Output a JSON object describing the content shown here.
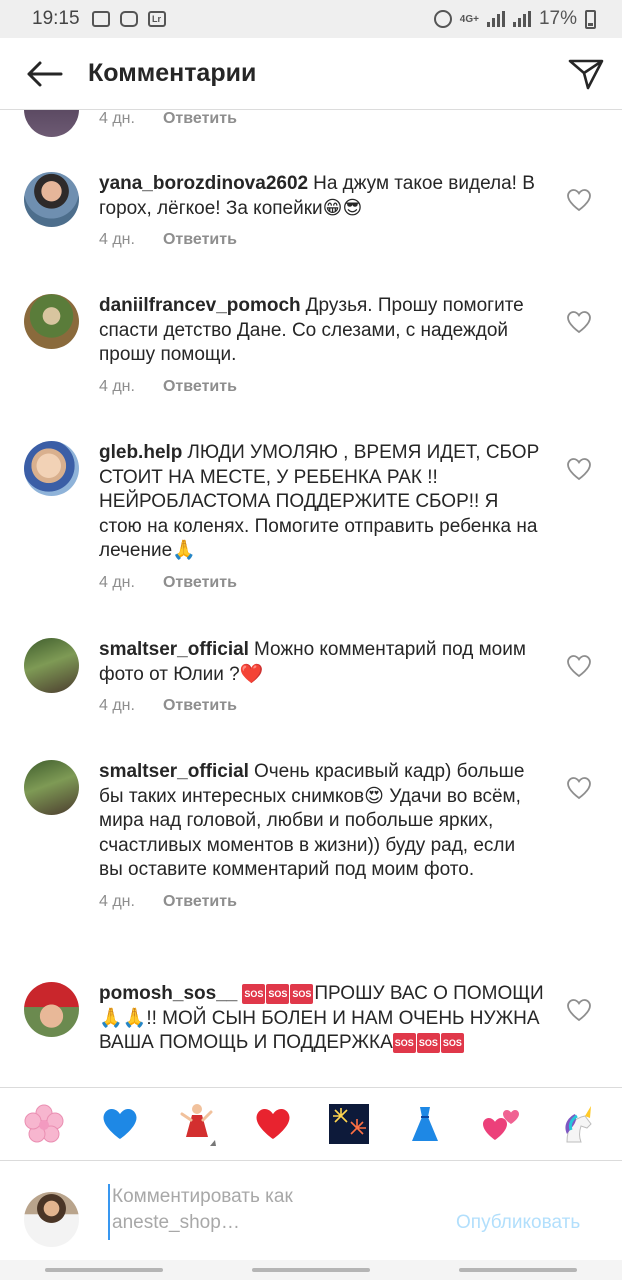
{
  "status_bar": {
    "time": "19:15",
    "network": "4G+",
    "battery": "17%",
    "lr_label": "Lr"
  },
  "header": {
    "title": "Комментарии"
  },
  "labels": {
    "reply": "Ответить"
  },
  "partial_comment": {
    "time": "4 дн."
  },
  "comments": [
    {
      "username": "yana_borozdinova2602",
      "text": "На джум такое видела! В горох, лёгкое! За копейки😁😎",
      "time": "4 дн."
    },
    {
      "username": "daniilfrancev_pomoch",
      "text": "Друзья. Прошу помогите спасти детство Дане. Со слезами, с надеждой прошу помощи.",
      "time": "4 дн."
    },
    {
      "username": "gleb.help",
      "text": "ЛЮДИ УМОЛЯЮ , ВРЕМЯ ИДЕТ, СБОР СТОИТ НА МЕСТЕ, У РЕБЕНКА РАК !! НЕЙРОБЛАСТОМА ПОДДЕРЖИТЕ СБОР!! Я стою на коленях. Помогите отправить ребенка на лечение🙏",
      "time": "4 дн."
    },
    {
      "username": "smaltser_official",
      "text": "Можно комментарий под моим фото от Юлии ?❤️",
      "time": "4 дн."
    },
    {
      "username": "smaltser_official",
      "text": "Очень красивый кадр) больше бы таких интересных снимков😍 Удачи во всём, мира над головой, любви и побольше ярких, счастливых моментов в жизни)) буду рад, если вы оставите комментарий под моим фото.",
      "time": "4 дн."
    },
    {
      "username": "pomosh_sos__",
      "text_a": "ПРОШУ ВАС О ПОМОЩИ🙏🙏!! МОЙ СЫН БОЛЕН И НАМ ОЧЕНЬ НУЖНА ВАША ПОМОЩЬ И ПОДДЕРЖКА",
      "sos": "SOS"
    }
  ],
  "emoji_bar": [
    "🌸",
    "💙",
    "💃",
    "❤️",
    "🎆",
    "👗",
    "💕",
    "🦄"
  ],
  "input": {
    "placeholder_line1": "Комментировать как",
    "placeholder_line2": "aneste_shop…",
    "publish_label": "Опубликовать"
  },
  "colors": {
    "link_disabled": "#b2dffc",
    "cursor": "#3897f0",
    "sos_badge": "#e0384a"
  }
}
